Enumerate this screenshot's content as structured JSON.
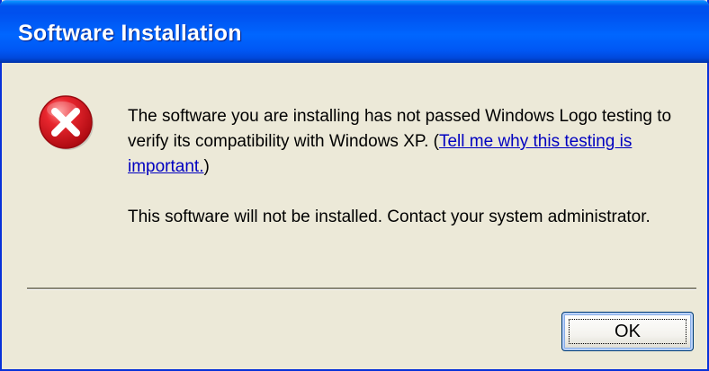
{
  "window": {
    "title": "Software Installation"
  },
  "icon": {
    "name": "error-icon",
    "color": "#d4121b"
  },
  "message": {
    "paragraph1_text": "The software you are installing has not passed Windows Logo testing to verify its compatibility with Windows XP. (",
    "paragraph1_link": "Tell me why this testing is important.",
    "paragraph1_suffix": ")",
    "paragraph2": "This software will not be installed. Contact your system administrator."
  },
  "buttons": {
    "ok_label": "OK"
  },
  "colors": {
    "titlebar": "#0055ea",
    "dialog_background": "#ece9d8",
    "link": "#0000c0"
  }
}
